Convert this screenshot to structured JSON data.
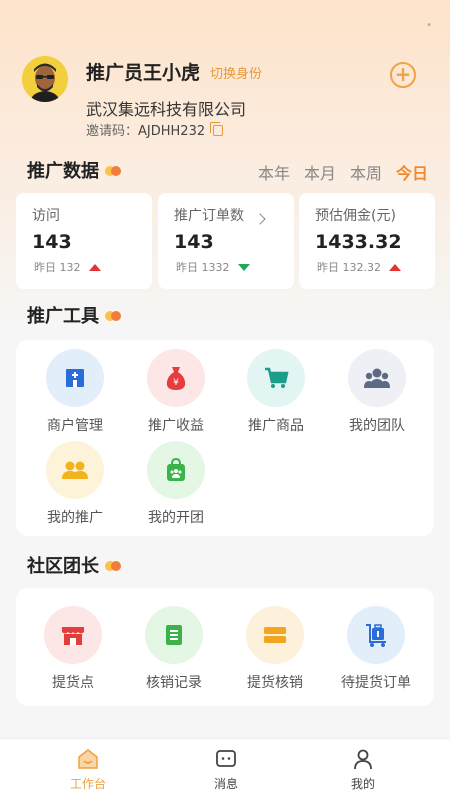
{
  "profile": {
    "name": "推广员王小虎",
    "switch_role": "切换身份",
    "company": "武汉集远科技有限公司",
    "invite_label": "邀请码：",
    "invite_code": "AJDHH232"
  },
  "stats_section": {
    "title": "推广数据",
    "tabs": [
      "本年",
      "本月",
      "本周",
      "今日"
    ],
    "active_tab": "今日",
    "cards": [
      {
        "label": "访问",
        "value": "143",
        "yesterday": "昨日 132",
        "trend": "up"
      },
      {
        "label": "推广订单数",
        "value": "143",
        "yesterday": "昨日 1332",
        "trend": "down"
      },
      {
        "label": "预估佣金(元)",
        "value": "1433.32",
        "yesterday": "昨日 132.32",
        "trend": "up"
      }
    ]
  },
  "tools_section": {
    "title": "推广工具",
    "items": [
      {
        "label": "商户管理",
        "icon": "store-building-icon"
      },
      {
        "label": "推广收益",
        "icon": "money-bag-icon"
      },
      {
        "label": "推广商品",
        "icon": "shopping-cart-icon"
      },
      {
        "label": "我的团队",
        "icon": "team-icon"
      },
      {
        "label": "我的推广",
        "icon": "users-icon"
      },
      {
        "label": "我的开团",
        "icon": "group-bag-icon"
      }
    ]
  },
  "community_section": {
    "title": "社区团长",
    "items": [
      {
        "label": "提货点",
        "icon": "shop-awning-icon"
      },
      {
        "label": "核销记录",
        "icon": "document-list-icon"
      },
      {
        "label": "提货核销",
        "icon": "ticket-icon"
      },
      {
        "label": "待提货订单",
        "icon": "luggage-cart-icon"
      }
    ]
  },
  "bottom_nav": {
    "items": [
      {
        "label": "工作台",
        "icon": "workbench-icon",
        "active": true
      },
      {
        "label": "消息",
        "icon": "message-icon",
        "active": false
      },
      {
        "label": "我的",
        "icon": "user-icon",
        "active": false
      }
    ]
  },
  "colors": {
    "accent": "#f08a2c",
    "trend_up": "#e23434",
    "trend_down": "#1ea85a"
  }
}
